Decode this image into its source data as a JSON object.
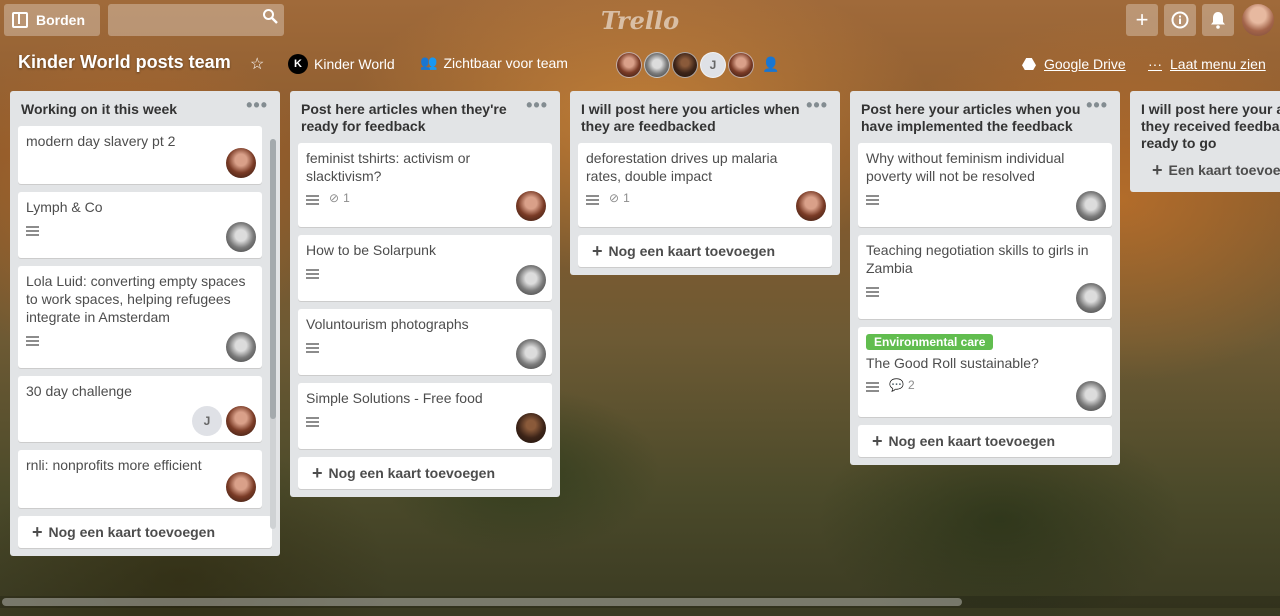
{
  "topbar": {
    "boards_label": "Borden",
    "search_placeholder": "",
    "logo_text": "Trello",
    "plus": "+",
    "info": "i"
  },
  "board": {
    "title": "Kinder World posts team",
    "team_logo": "K",
    "team_name": "Kinder World",
    "visibility": "Zichtbaar voor team",
    "member_j": "J",
    "gdrive": "Google Drive",
    "menu": "Laat menu zien"
  },
  "lists": [
    {
      "title": "Working on it this week",
      "cards": [
        {
          "title": "modern day slavery pt 2"
        },
        {
          "title": "Lymph & Co"
        },
        {
          "title": "Lola Luid: converting empty spaces to work spaces, helping refugees integrate in Amsterdam"
        },
        {
          "title": "30 day challenge",
          "member_j": "J"
        },
        {
          "title": "rnli: nonprofits more efficient"
        }
      ],
      "add_label": "Nog een kaart toevoegen"
    },
    {
      "title": "Post here articles when they're ready for feedback",
      "cards": [
        {
          "title": "feminist tshirts: activism or slacktivism?",
          "attachments": "1"
        },
        {
          "title": "How to be Solarpunk"
        },
        {
          "title": "Voluntourism photographs"
        },
        {
          "title": "Simple Solutions - Free food"
        }
      ],
      "add_label": "Nog een kaart toevoegen"
    },
    {
      "title": "I will post here you articles when they are feedbacked",
      "cards": [
        {
          "title": "deforestation drives up malaria rates, double impact",
          "attachments": "1"
        }
      ],
      "add_label": "Nog een kaart toevoegen"
    },
    {
      "title": "Post here your articles when you have implemented the feedback",
      "cards": [
        {
          "title": "Why without feminism individual poverty will not be resolved"
        },
        {
          "title": "Teaching negotiation skills to girls in Zambia"
        },
        {
          "title": "The Good Roll sustainable?",
          "label": "Environmental care",
          "comments": "2"
        }
      ],
      "add_label": "Nog een kaart toevoegen"
    },
    {
      "title": "I will post here your articles when they received feedback and they're ready to go",
      "cards": [],
      "add_label": "Een kaart toevoegen"
    }
  ],
  "colors": {
    "list_bg": "#e2e4e6",
    "label_green": "#61bd4f"
  }
}
